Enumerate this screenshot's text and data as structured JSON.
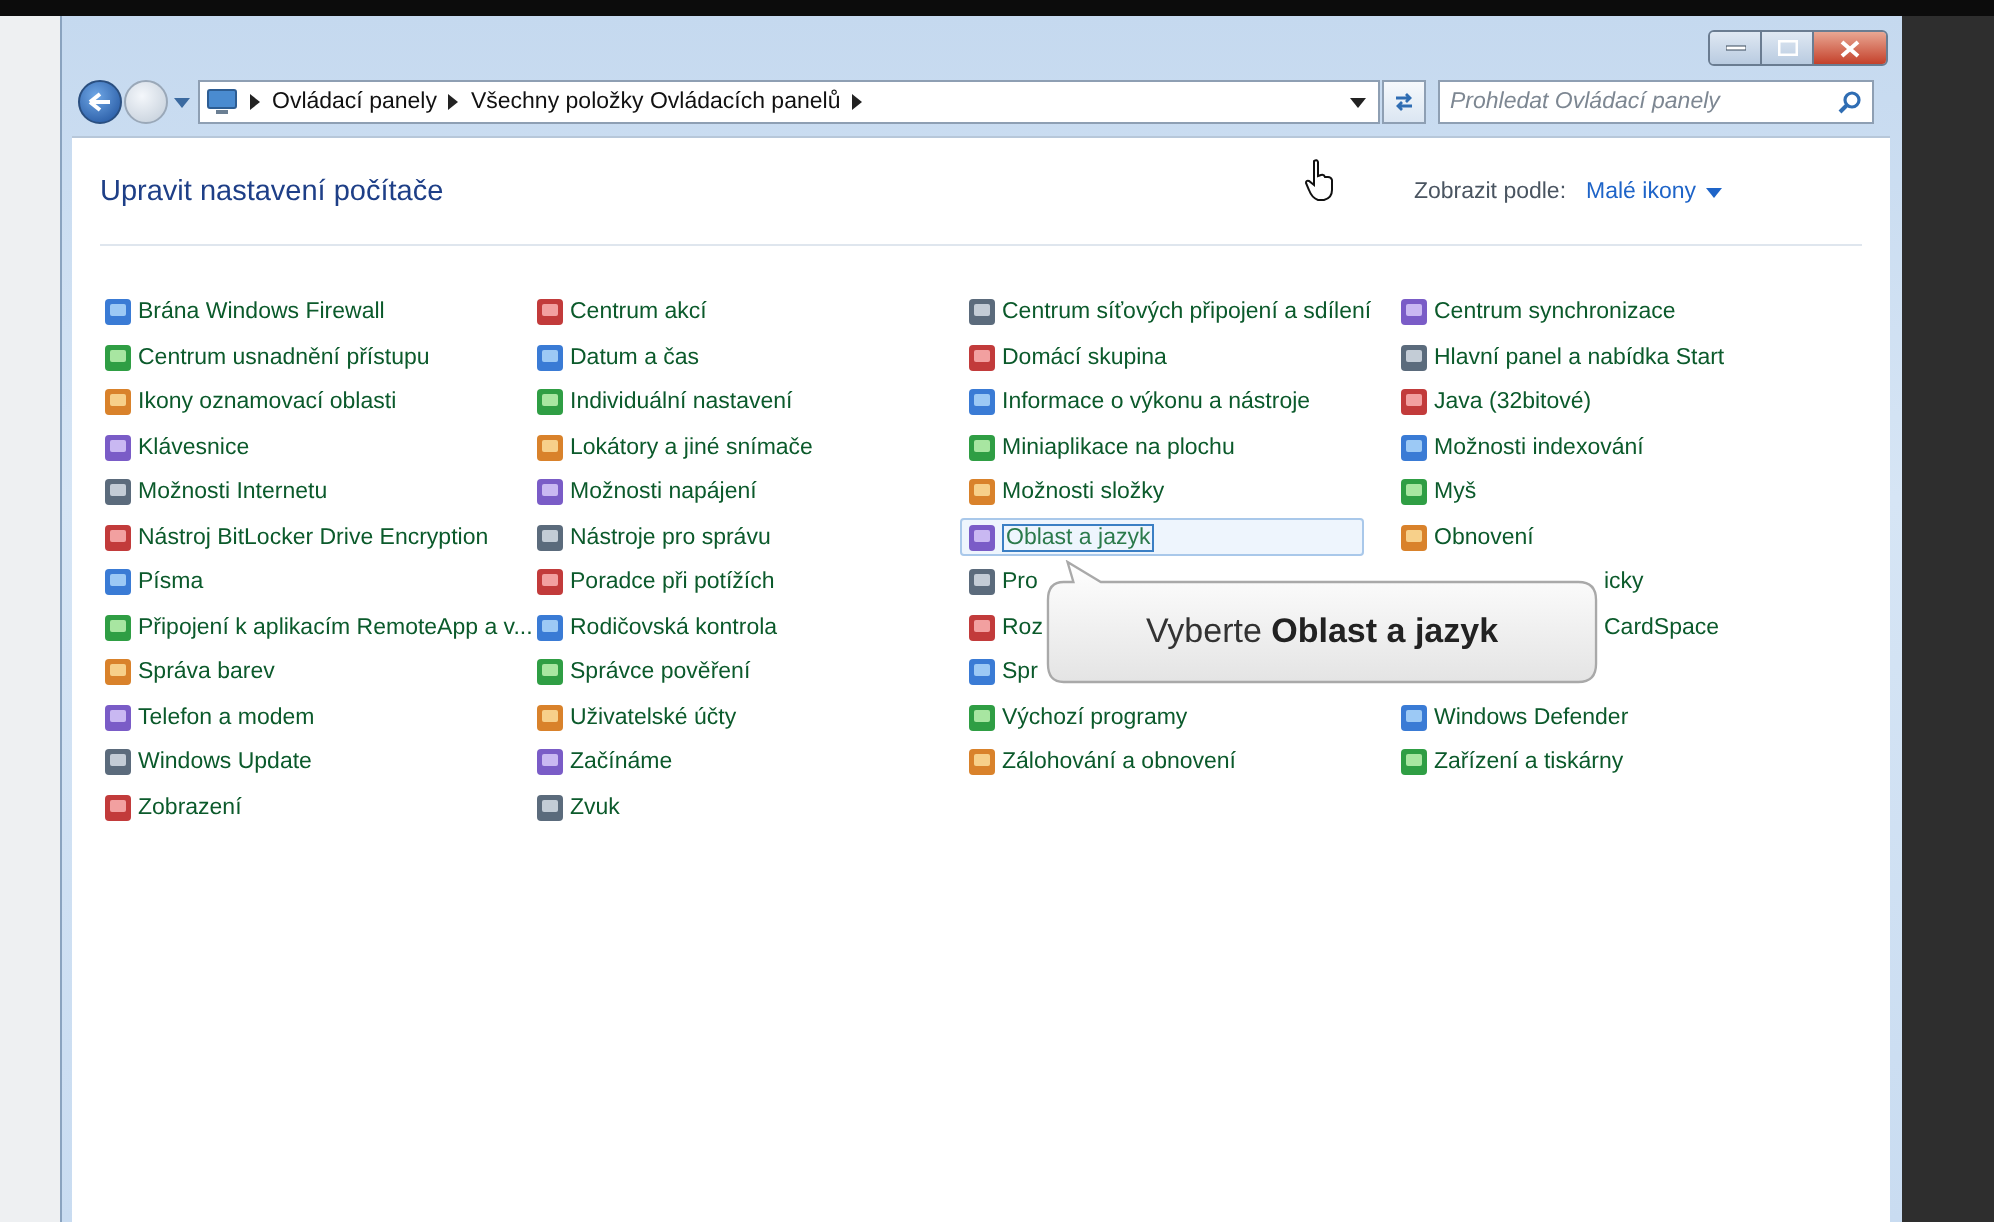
{
  "address_bar": {
    "breadcrumbs": [
      "Ovládací panely",
      "Všechny položky Ovládacích panelů"
    ]
  },
  "search": {
    "placeholder": "Prohledat Ovládací panely"
  },
  "header": {
    "title": "Upravit nastavení počítače",
    "view_label": "Zobrazit podle:",
    "view_value": "Malé ikony"
  },
  "columns": [
    [
      {
        "kind": "item",
        "label": "Brána Windows Firewall",
        "selected": false
      },
      {
        "kind": "item",
        "label": "Centrum usnadnění přístupu",
        "selected": false
      },
      {
        "kind": "item",
        "label": "Ikony oznamovací oblasti",
        "selected": false
      },
      {
        "kind": "item",
        "label": "Klávesnice",
        "selected": false
      },
      {
        "kind": "item",
        "label": "Možnosti Internetu",
        "selected": false
      },
      {
        "kind": "item",
        "label": "Nástroj BitLocker Drive Encryption",
        "selected": false
      },
      {
        "kind": "item",
        "label": "Písma",
        "selected": false
      },
      {
        "kind": "item",
        "label": "Připojení k aplikacím RemoteApp a v...",
        "selected": false
      },
      {
        "kind": "item",
        "label": "Správa barev",
        "selected": false
      },
      {
        "kind": "item",
        "label": "Telefon a modem",
        "selected": false
      },
      {
        "kind": "item",
        "label": "Windows Update",
        "selected": false
      },
      {
        "kind": "item",
        "label": "Zobrazení",
        "selected": false
      }
    ],
    [
      {
        "kind": "item",
        "label": "Centrum akcí",
        "selected": false
      },
      {
        "kind": "item",
        "label": "Datum a čas",
        "selected": false
      },
      {
        "kind": "item",
        "label": "Individuální nastavení",
        "selected": false
      },
      {
        "kind": "item",
        "label": "Lokátory a jiné snímače",
        "selected": false
      },
      {
        "kind": "item",
        "label": "Možnosti napájení",
        "selected": false
      },
      {
        "kind": "item",
        "label": "Nástroje pro správu",
        "selected": false
      },
      {
        "kind": "item",
        "label": "Poradce při potížích",
        "selected": false
      },
      {
        "kind": "item",
        "label": "Rodičovská kontrola",
        "selected": false
      },
      {
        "kind": "item",
        "label": "Správce pověření",
        "selected": false
      },
      {
        "kind": "item",
        "label": "Uživatelské účty",
        "selected": false
      },
      {
        "kind": "item",
        "label": "Začínáme",
        "selected": false
      },
      {
        "kind": "item",
        "label": "Zvuk",
        "selected": false
      }
    ],
    [
      {
        "kind": "item",
        "label": "Centrum síťových připojení a sdílení",
        "selected": false
      },
      {
        "kind": "item",
        "label": "Domácí skupina",
        "selected": false
      },
      {
        "kind": "item",
        "label": "Informace o výkonu a nástroje",
        "selected": false
      },
      {
        "kind": "item",
        "label": "Miniaplikace na plochu",
        "selected": false
      },
      {
        "kind": "item",
        "label": "Možnosti složky",
        "selected": false
      },
      {
        "kind": "item",
        "label": "Oblast a jazyk",
        "selected": true
      },
      {
        "kind": "item",
        "label": "Pro",
        "selected": false
      },
      {
        "kind": "item",
        "label": "Roz",
        "selected": false
      },
      {
        "kind": "item",
        "label": "Spr",
        "selected": false
      },
      {
        "kind": "item",
        "label": "Výchozí programy",
        "selected": false
      },
      {
        "kind": "item",
        "label": "Zálohování a obnovení",
        "selected": false
      }
    ],
    [
      {
        "kind": "item",
        "label": "Centrum synchronizace",
        "selected": false
      },
      {
        "kind": "item",
        "label": "Hlavní panel a nabídka Start",
        "selected": false
      },
      {
        "kind": "item",
        "label": "Java (32bitové)",
        "selected": false
      },
      {
        "kind": "item",
        "label": "Možnosti indexování",
        "selected": false
      },
      {
        "kind": "item",
        "label": "Myš",
        "selected": false
      },
      {
        "kind": "item",
        "label": "Obnovení",
        "selected": false
      },
      {
        "kind": "cut_start",
        "label": "icky",
        "selected": false
      },
      {
        "kind": "cut_start",
        "label": "CardSpace",
        "selected": false
      },
      {
        "kind": "covered"
      },
      {
        "kind": "item",
        "label": "Windows Defender",
        "selected": false
      },
      {
        "kind": "item",
        "label": "Zařízení a tiskárny",
        "selected": false
      }
    ]
  ],
  "callout": {
    "text": "Vyberte **Oblast a jazyk**"
  }
}
